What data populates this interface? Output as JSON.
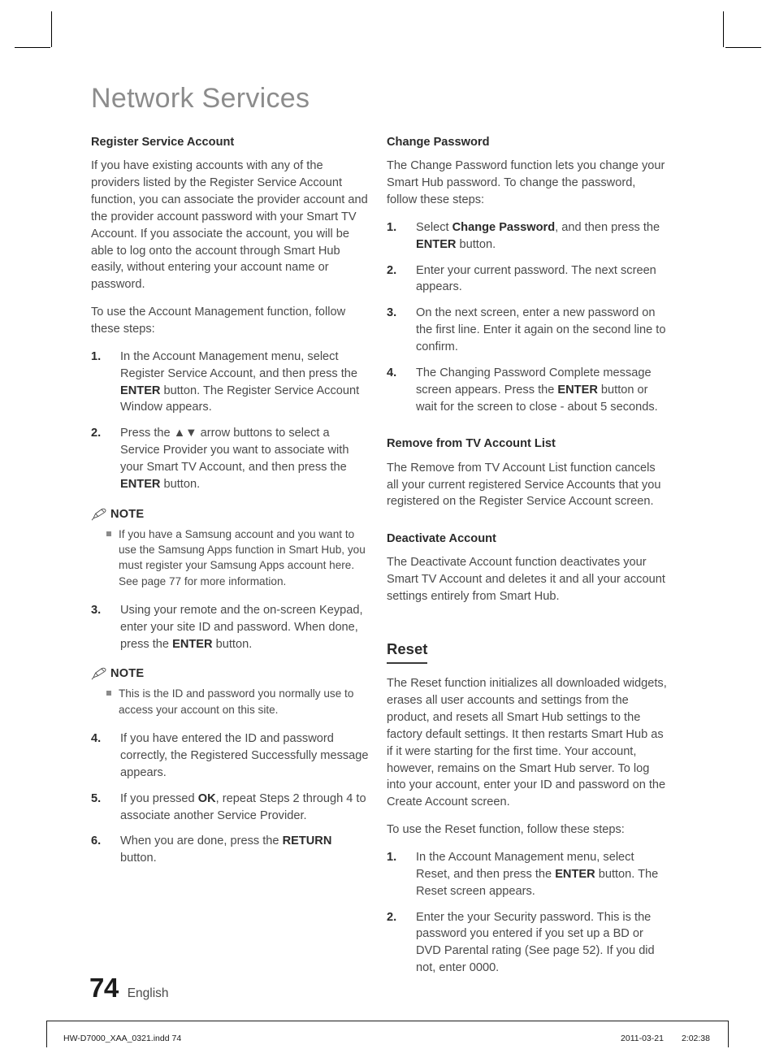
{
  "document": {
    "chapter_title": "Network Services",
    "page_number": "74",
    "language": "English"
  },
  "left_column": {
    "heading": "Register Service Account",
    "intro_paragraph_1": "If you have existing accounts with any of the providers listed by the Register Service Account function, you can associate the provider account and the provider account password with your Smart TV Account. If you associate the account, you will be able to log onto the account through Smart Hub easily, without entering your account name or password.",
    "intro_paragraph_2": "To use the Account Management function, follow these steps:",
    "steps_1_2": [
      {
        "num": "1.",
        "text_html": "In the Account Management menu, select Register Service Account, and then press the <b>ENTER</b> button. The Register Service Account Window appears."
      },
      {
        "num": "2.",
        "text_html": "Press the &#9650;&#9660; arrow buttons to select a Service Provider you want to associate with your Smart TV Account, and then press the <b>ENTER</b> button."
      }
    ],
    "note_1": {
      "label": "NOTE",
      "items": [
        "If you have a Samsung account and you want to use the Samsung Apps function in Smart Hub, you must register your Samsung Apps account here. See page 77 for more information."
      ]
    },
    "step_3": [
      {
        "num": "3.",
        "text_html": "Using your remote and the on-screen Keypad, enter your site ID and password. When done, press the <b>ENTER</b> button."
      }
    ],
    "note_2": {
      "label": "NOTE",
      "items": [
        "This is the ID and password you normally use to access your account on this site."
      ]
    },
    "steps_4_6": [
      {
        "num": "4.",
        "text_html": "If you have entered the ID and password correctly, the Registered Successfully message appears."
      },
      {
        "num": "5.",
        "text_html": "If you pressed <b>OK</b>, repeat Steps 2 through 4 to associate another Service Provider."
      },
      {
        "num": "6.",
        "text_html": "When you are done, press the <b>RETURN</b> button."
      }
    ]
  },
  "right_column": {
    "change_password": {
      "heading": "Change Password",
      "paragraph": "The Change Password function lets you change your Smart Hub password. To change the password, follow these steps:",
      "steps": [
        {
          "num": "1.",
          "text_html": "Select <b>Change Password</b>, and then press the <b>ENTER</b> button."
        },
        {
          "num": "2.",
          "text_html": "Enter your current password. The next screen appears."
        },
        {
          "num": "3.",
          "text_html": "On the next screen, enter a new password on the first line. Enter it again on the second line to confirm."
        },
        {
          "num": "4.",
          "text_html": "The Changing Password Complete message screen appears. Press the <b>ENTER</b> button or wait for the screen to close - about 5 seconds."
        }
      ]
    },
    "remove_from_tv_account_list": {
      "heading": "Remove from TV Account List",
      "paragraph": "The Remove from TV Account List function cancels all your current registered Service Accounts that you registered on the Register Service Account screen."
    },
    "deactivate_account": {
      "heading": "Deactivate Account",
      "paragraph": "The Deactivate Account function deactivates your Smart TV Account and deletes it and all your account settings entirely from Smart Hub."
    },
    "reset": {
      "heading": "Reset",
      "paragraph_1": "The Reset function initializes all downloaded widgets, erases all user accounts and settings from the product, and resets all Smart Hub settings to the factory default settings. It then restarts Smart Hub as if it were starting for the first time. Your account, however, remains on the Smart Hub server. To log into your account, enter your ID and password on the Create Account screen.",
      "paragraph_2": "To use the Reset function, follow these steps:",
      "steps": [
        {
          "num": "1.",
          "text_html": "In the Account Management menu, select Reset, and then press the <b>ENTER</b> button. The Reset screen appears."
        },
        {
          "num": "2.",
          "text_html": "Enter the your Security password. This is the password you entered if you set up a BD or DVD Parental rating (See page 52). If you did not, enter 0000."
        }
      ]
    }
  },
  "footer": {
    "file_name": "HW-D7000_XAA_0321.indd   74",
    "date": "2011-03-21",
    "time": "2:02:38"
  }
}
